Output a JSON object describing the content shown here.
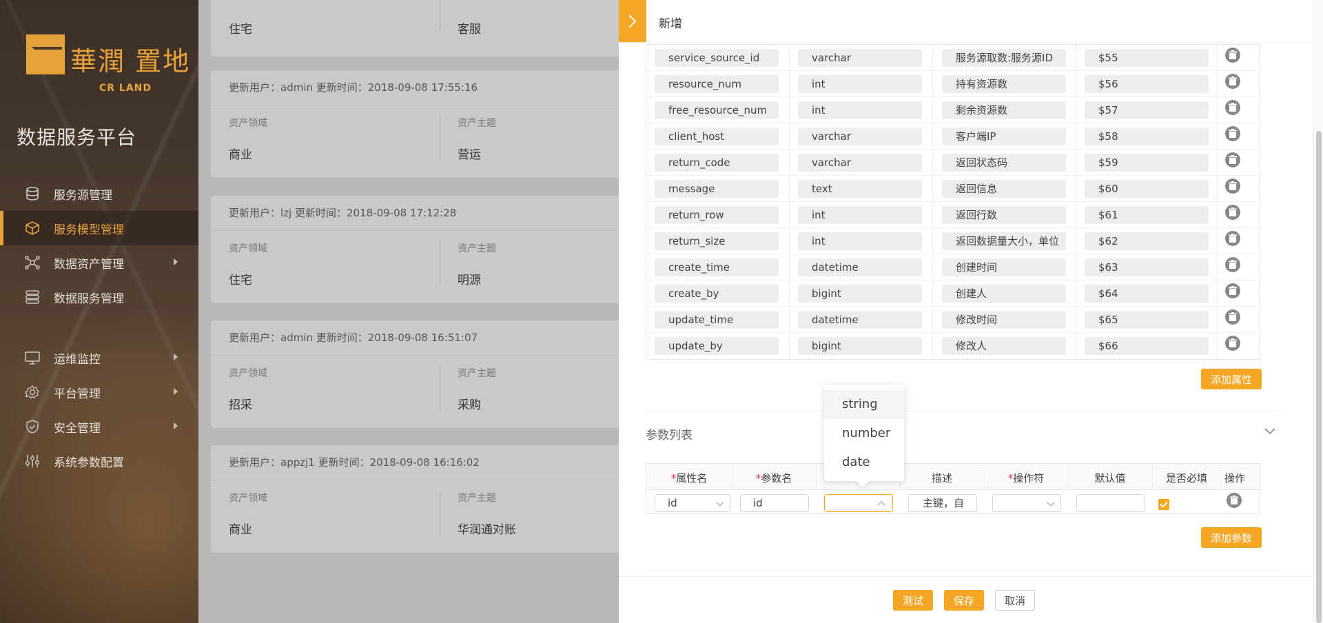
{
  "sidebar": {
    "logo_cn": "華潤 置地",
    "logo_en": "CR LAND",
    "platform_title": "数据服务平台",
    "items": [
      {
        "label": "服务源管理",
        "icon": "database-icon"
      },
      {
        "label": "服务模型管理",
        "icon": "cube-icon",
        "active": true
      },
      {
        "label": "数据资产管理",
        "icon": "network-icon",
        "has_children": true
      },
      {
        "label": "数据服务管理",
        "icon": "server-stack-icon"
      },
      {
        "label": "运维监控",
        "icon": "monitor-icon",
        "has_children": true
      },
      {
        "label": "平台管理",
        "icon": "gear-icon",
        "has_children": true
      },
      {
        "label": "安全管理",
        "icon": "shield-icon",
        "has_children": true
      },
      {
        "label": "系统参数配置",
        "icon": "sliders-icon"
      }
    ]
  },
  "cards": [
    {
      "update": "",
      "domain_label": "",
      "domain": "住宅",
      "topic_label": "",
      "topic": "客服"
    },
    {
      "update": "更新用户：admin 更新时间：2018-09-08 17:55:16",
      "domain_label": "资产领域",
      "domain": "商业",
      "topic_label": "资产主题",
      "topic": "营运"
    },
    {
      "update": "更新用户：lzj 更新时间：2018-09-08 17:12:28",
      "domain_label": "资产领域",
      "domain": "住宅",
      "topic_label": "资产主题",
      "topic": "明源"
    },
    {
      "update": "更新用户：admin 更新时间：2018-09-08 16:51:07",
      "domain_label": "资产领域",
      "domain": "招采",
      "topic_label": "资产主题",
      "topic": "采购"
    },
    {
      "update": "更新用户：appzj1 更新时间：2018-09-08 16:16:02",
      "domain_label": "资产领域",
      "domain": "商业",
      "topic_label": "资产主题",
      "topic": "华润通对账"
    }
  ],
  "panel": {
    "title": "新增",
    "attributes": [
      {
        "name": "service_source_id",
        "type": "varchar",
        "desc": "服务源取数:服务源ID",
        "var": "$55"
      },
      {
        "name": "resource_num",
        "type": "int",
        "desc": "持有资源数",
        "var": "$56"
      },
      {
        "name": "free_resource_num",
        "type": "int",
        "desc": "剩余资源数",
        "var": "$57"
      },
      {
        "name": "client_host",
        "type": "varchar",
        "desc": "客户端IP",
        "var": "$58"
      },
      {
        "name": "return_code",
        "type": "varchar",
        "desc": "返回状态码",
        "var": "$59"
      },
      {
        "name": "message",
        "type": "text",
        "desc": "返回信息",
        "var": "$60"
      },
      {
        "name": "return_row",
        "type": "int",
        "desc": "返回行数",
        "var": "$61"
      },
      {
        "name": "return_size",
        "type": "int",
        "desc": "返回数据量大小，单位",
        "var": "$62"
      },
      {
        "name": "create_time",
        "type": "datetime",
        "desc": "创建时间",
        "var": "$63"
      },
      {
        "name": "create_by",
        "type": "bigint",
        "desc": "创建人",
        "var": "$64"
      },
      {
        "name": "update_time",
        "type": "datetime",
        "desc": "修改时间",
        "var": "$65"
      },
      {
        "name": "update_by",
        "type": "bigint",
        "desc": "修改人",
        "var": "$66"
      }
    ],
    "add_attribute_label": "添加属性",
    "param_section_title": "参数列表",
    "param_headers": {
      "attr_name": "属性名",
      "param_name": "参数名",
      "type": "",
      "desc": "描述",
      "operator": "操作符",
      "default": "默认值",
      "required": "是否必填",
      "action": "操作"
    },
    "param_row": {
      "attr_name": "id",
      "param_name": "id",
      "type": "",
      "desc": "主键，自",
      "operator": "",
      "default": "",
      "required": true
    },
    "type_options": [
      "string",
      "number",
      "date"
    ],
    "add_param_label": "添加参数",
    "footer": {
      "test": "测试",
      "save": "保存",
      "cancel": "取消"
    }
  },
  "colors": {
    "accent": "#f5a623",
    "required_star": "#e34"
  }
}
